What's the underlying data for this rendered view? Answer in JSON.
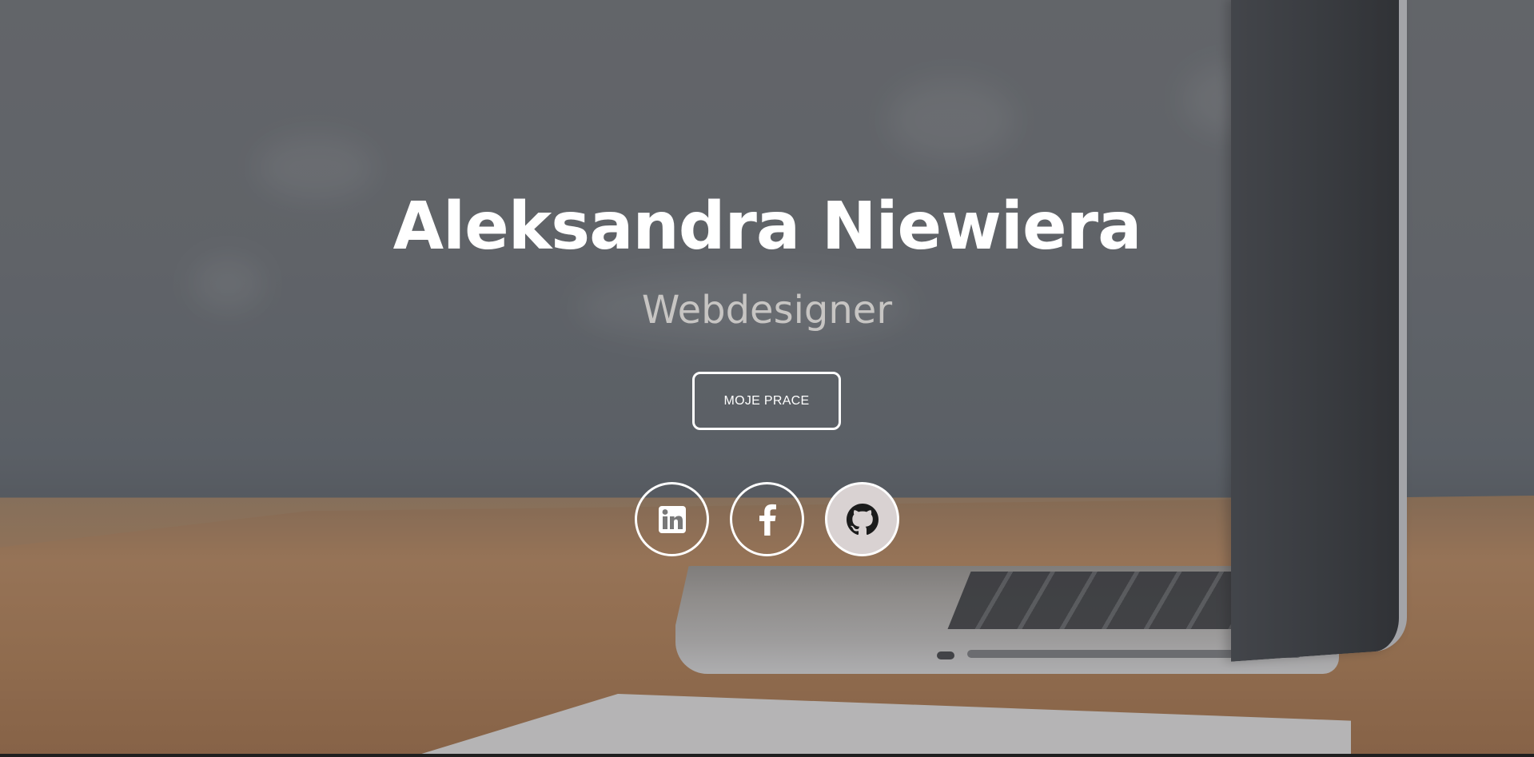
{
  "hero": {
    "name": "Aleksandra Niewiera",
    "role": "Webdesigner",
    "cta_label": "MOJE PRACE"
  },
  "socials": [
    {
      "icon": "linkedin-icon",
      "name": "linkedin"
    },
    {
      "icon": "facebook-icon",
      "name": "facebook"
    },
    {
      "icon": "github-icon",
      "name": "github"
    }
  ],
  "colors": {
    "title": "#ffffff",
    "subtitle": "#c7c5c3",
    "button_border": "#ffffff",
    "social_active_bg": "#d9d2d2"
  }
}
